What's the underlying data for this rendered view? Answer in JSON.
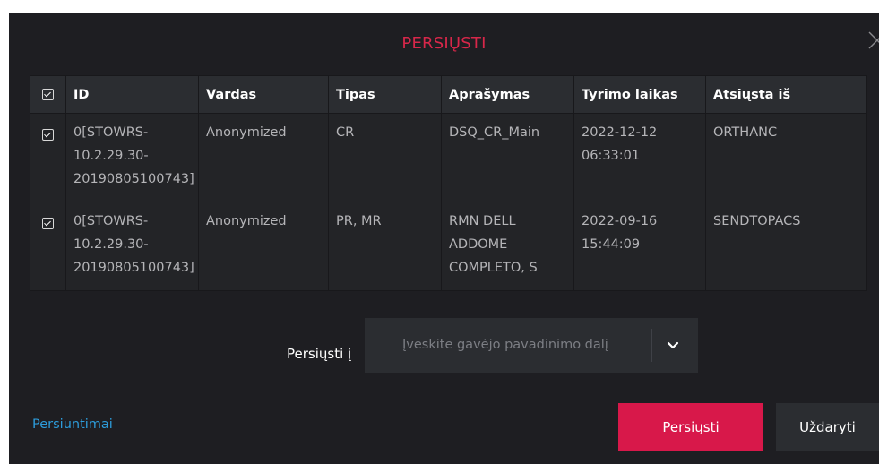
{
  "dialog": {
    "title": "PERSIŲSTI"
  },
  "table": {
    "columns": [
      "ID",
      "Vardas",
      "Tipas",
      "Aprašymas",
      "Tyrimo laikas",
      "Atsiųsta iš"
    ],
    "rows": [
      {
        "checked": true,
        "id": [
          "0[STOWRS-",
          "10.2.29.30-",
          "20190805100743]"
        ],
        "name": "Anonymized",
        "type": "CR",
        "description": [
          "DSQ_CR_Main"
        ],
        "time": [
          "2022-12-12",
          "06:33:01"
        ],
        "source": "ORTHANC"
      },
      {
        "checked": true,
        "id": [
          "0[STOWRS-",
          "10.2.29.30-",
          "20190805100743]"
        ],
        "name": "Anonymized",
        "type": "PR, MR",
        "description": [
          "RMN DELL",
          "ADDOME",
          "COMPLETO, S"
        ],
        "time": [
          "2022-09-16",
          "15:44:09"
        ],
        "source": "SENDTOPACS"
      }
    ]
  },
  "destination": {
    "label": "Persiųsti į",
    "placeholder": "Įveskite gavėjo pavadinimo dalį"
  },
  "footer": {
    "link_label": "Persiuntimai",
    "send_label": "Persiųsti",
    "close_label": "Uždaryti"
  },
  "colors": {
    "accent": "#d8184a",
    "link": "#2d9cdb",
    "dialog_bg": "#1e1e22"
  }
}
